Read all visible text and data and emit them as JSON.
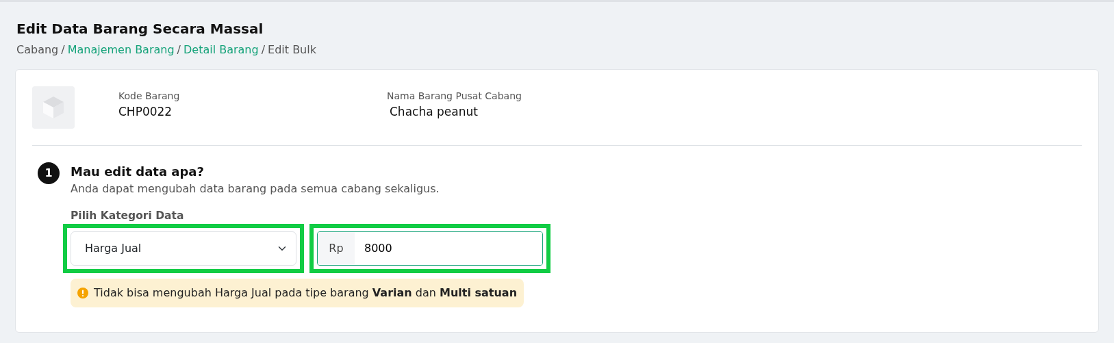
{
  "page": {
    "title": "Edit Data Barang Secara Massal"
  },
  "breadcrumb": {
    "separator": "/",
    "items": [
      {
        "label": "Cabang",
        "link": false
      },
      {
        "label": "Manajemen Barang",
        "link": true
      },
      {
        "label": "Detail Barang",
        "link": true
      },
      {
        "label": "Edit Bulk",
        "link": false
      }
    ]
  },
  "product": {
    "fields": [
      {
        "label": "Kode Barang",
        "value": "CHP0022"
      },
      {
        "label": "Nama Barang Pusat Cabang",
        "value": "Chacha peanut"
      }
    ]
  },
  "step": {
    "number": "1",
    "title": "Mau edit data apa?",
    "description": "Anda dapat mengubah data barang pada semua cabang sekaligus.",
    "category_label": "Pilih Kategori Data",
    "category_select": {
      "value": "Harga Jual",
      "highlighted": true
    },
    "price_input": {
      "prefix": "Rp",
      "value": "8000",
      "focused": true,
      "highlighted": true
    },
    "warning": "Tidak bisa mengubah Harga Jual pada tipe barang **Varian** dan **Multi satuan**"
  }
}
